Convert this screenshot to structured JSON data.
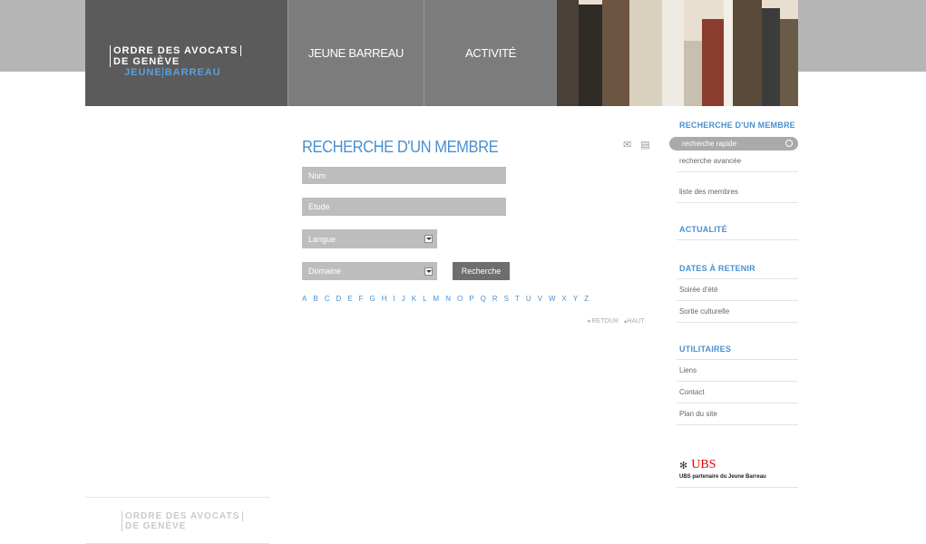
{
  "header": {
    "logo_line1": "ORDRE DES AVOCATS",
    "logo_line2": "DE GENÈVE",
    "logo_jeune": "JEUNE",
    "logo_barreau": "BARREAU",
    "nav": [
      "JEUNE BARREAU",
      "ACTIVITÉ"
    ]
  },
  "main": {
    "title": "RECHERCHE D'UN MEMBRE",
    "fields": {
      "nom_placeholder": "Nom",
      "etude_placeholder": "Etude",
      "langue_selected": "Langue",
      "domaine_selected": "Domaine"
    },
    "search_button": "Recherche",
    "alphabet": [
      "A",
      "B",
      "C",
      "D",
      "E",
      "F",
      "G",
      "H",
      "I",
      "J",
      "K",
      "L",
      "M",
      "N",
      "O",
      "P",
      "Q",
      "R",
      "S",
      "T",
      "U",
      "V",
      "W",
      "X",
      "Y",
      "Z"
    ],
    "retour": "RETOUR",
    "haut": "HAUT"
  },
  "sidebar": {
    "recherche_head": "RECHERCHE D'UN MEMBRE",
    "quick_search": "recherche rapide",
    "advanced": "recherche avancée",
    "members_list": "liste des membres",
    "actualite_head": "ACTUALITÉ",
    "dates_head": "DATES À RETENIR",
    "dates_items": [
      "Soirée d'été",
      "Sortie culturelle"
    ],
    "utilitaires_head": "UTILITAIRES",
    "utilitaires_items": [
      "Liens",
      "Contact",
      "Plan du site"
    ],
    "sponsor_name": "UBS",
    "sponsor_caption": "UBS partenaire du Jeune Barreau"
  },
  "footer": {
    "logo_line1": "ORDRE DES AVOCATS",
    "logo_line2": "DE GENÈVE"
  }
}
